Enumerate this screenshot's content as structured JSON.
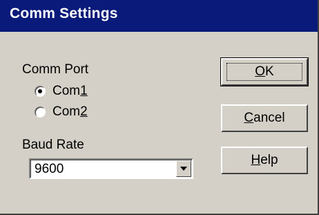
{
  "window": {
    "title": "Comm Settings"
  },
  "comm_port": {
    "label": "Comm Port",
    "options": [
      {
        "text_pre": "Com",
        "mnemonic": "1",
        "text_post": "",
        "selected": true
      },
      {
        "text_pre": "Com",
        "mnemonic": "2",
        "text_post": "",
        "selected": false
      }
    ]
  },
  "baud_rate": {
    "label": "Baud Rate",
    "value": "9600"
  },
  "buttons": {
    "ok": {
      "mnemonic": "O",
      "rest": "K"
    },
    "cancel": {
      "mnemonic": "C",
      "rest": "ancel"
    },
    "help": {
      "mnemonic": "H",
      "rest": "elp"
    }
  },
  "colors": {
    "title_bg": "#0a1a7a",
    "dialog_bg": "#d4d0c8"
  },
  "icons": {
    "dropdown": "chevron-down-icon"
  }
}
